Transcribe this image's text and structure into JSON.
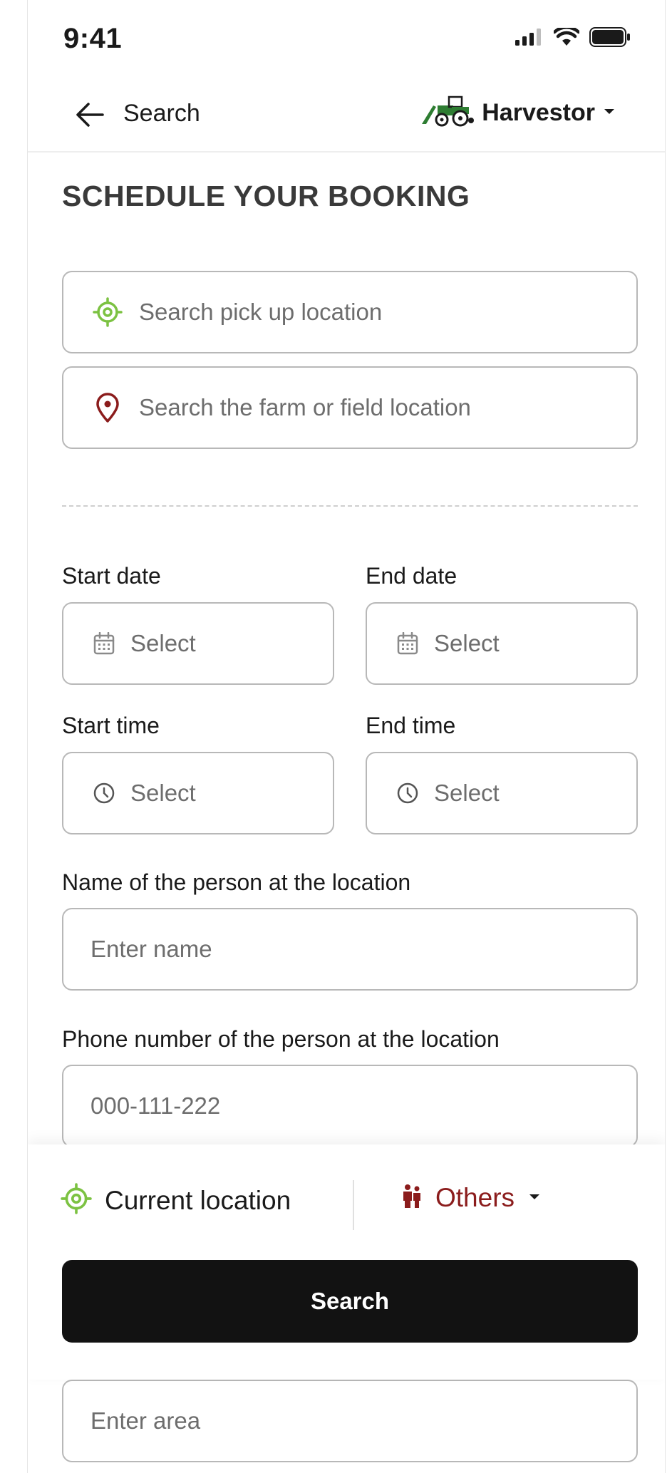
{
  "status_bar": {
    "time": "9:41"
  },
  "header": {
    "back_label": "Search",
    "brand_name": "Harvestor"
  },
  "page_title": "SCHEDULE YOUR BOOKING",
  "pickup": {
    "placeholder": "Search pick up location"
  },
  "farm": {
    "placeholder": "Search the farm or field location"
  },
  "start_date": {
    "label": "Start date",
    "placeholder": "Select"
  },
  "end_date": {
    "label": "End date",
    "placeholder": "Select"
  },
  "start_time": {
    "label": "Start time",
    "placeholder": "Select"
  },
  "end_time": {
    "label": "End time",
    "placeholder": "Select"
  },
  "person_name": {
    "label": "Name of the person at the location",
    "placeholder": "Enter name"
  },
  "person_phone": {
    "label": "Phone number of the person at the location",
    "placeholder": "000-111-222"
  },
  "area": {
    "placeholder": "Enter area"
  },
  "sheet": {
    "current_location": "Current location",
    "others": "Others",
    "search_button": "Search"
  },
  "colors": {
    "accent_green": "#7cc242",
    "accent_red": "#8b1c1c",
    "button_dark": "#121212"
  }
}
